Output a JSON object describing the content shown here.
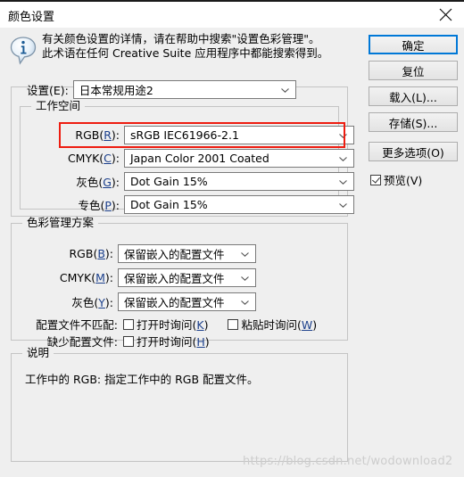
{
  "window": {
    "title": "颜色设置",
    "close_icon": "close-icon"
  },
  "info": {
    "icon": "info-bubble-icon",
    "line1": "有关颜色设置的详情，请在帮助中搜索\"设置色彩管理\"。",
    "line2": "此术语在任何 Creative Suite 应用程序中都能搜索得到。"
  },
  "buttons": {
    "ok": "确定",
    "reset": "复位",
    "load": "载入(L)...",
    "save": "存储(S)...",
    "more_options": "更多选项(O)",
    "primary_accent": "#0078d7"
  },
  "preview": {
    "label": "预览(V)",
    "checked": true
  },
  "settings": {
    "label": "设置(E):",
    "value": "日本常规用途2"
  },
  "working_spaces": {
    "legend": "工作空间",
    "highlight_color": "#ee1c10",
    "rows": [
      {
        "label_pre": "RGB(",
        "mnemonic": "R",
        "label_post": "):",
        "value": "sRGB IEC61966-2.1",
        "highlighted": true
      },
      {
        "label_pre": "CMYK(",
        "mnemonic": "C",
        "label_post": "):",
        "value": "Japan Color 2001 Coated",
        "highlighted": false
      },
      {
        "label_pre": "灰色(",
        "mnemonic": "G",
        "label_post": "):",
        "value": "Dot Gain 15%",
        "highlighted": false
      },
      {
        "label_pre": "专色(",
        "mnemonic": "P",
        "label_post": "):",
        "value": "Dot Gain 15%",
        "highlighted": false
      }
    ]
  },
  "policies": {
    "legend": "色彩管理方案",
    "rows": [
      {
        "label_pre": "RGB(",
        "mnemonic": "B",
        "label_post": "):",
        "value": "保留嵌入的配置文件"
      },
      {
        "label_pre": "CMYK(",
        "mnemonic": "M",
        "label_post": "):",
        "value": "保留嵌入的配置文件"
      },
      {
        "label_pre": "灰色(",
        "mnemonic": "Y",
        "label_post": "):",
        "value": "保留嵌入的配置文件"
      }
    ],
    "mismatch_label": "配置文件不匹配:",
    "mismatch_open_pre": "打开时询问(",
    "mismatch_open_mn": "K",
    "mismatch_open_post": ")",
    "mismatch_open_checked": false,
    "mismatch_paste_pre": "粘贴时询问(",
    "mismatch_paste_mn": "W",
    "mismatch_paste_post": ")",
    "mismatch_paste_checked": false,
    "missing_label": "缺少配置文件:",
    "missing_open_pre": "打开时询问(",
    "missing_open_mn": "H",
    "missing_open_post": ")",
    "missing_open_checked": false
  },
  "description": {
    "legend": "说明",
    "text": "工作中的 RGB: 指定工作中的 RGB 配置文件。"
  },
  "watermark": {
    "text": "https://blog.csdn.net/wodownload2"
  }
}
